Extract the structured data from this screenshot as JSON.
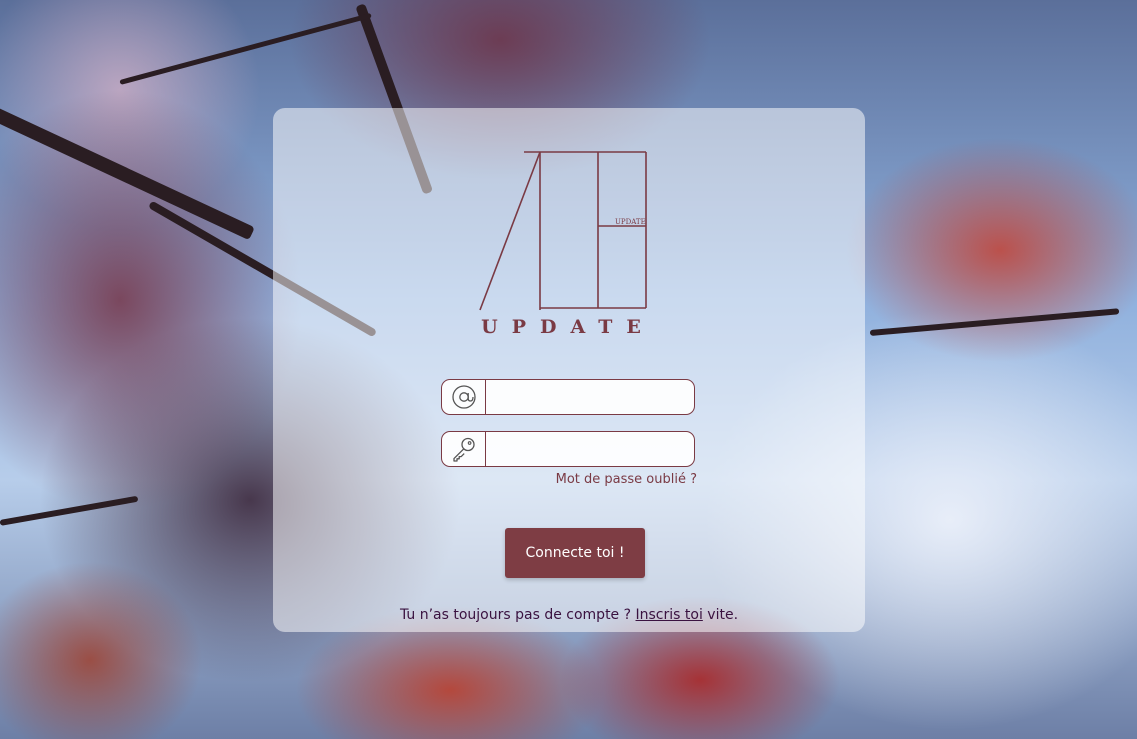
{
  "logo": {
    "name": "UPDATE",
    "small_text": "UPDATE",
    "color": "#7a3a44"
  },
  "email_field": {
    "icon": "at-sign-icon",
    "value": "",
    "placeholder": ""
  },
  "password_field": {
    "icon": "key-icon",
    "value": "",
    "placeholder": ""
  },
  "forgot_password": "Mot de passe oublié ?",
  "submit_label": "Connecte toi !",
  "signup": {
    "prefix": "Tu n’as toujours pas de compte ?",
    "link": "Inscris toi",
    "suffix": "vite."
  },
  "colors": {
    "accent": "#7e3d44",
    "text_dark": "#3a1240"
  }
}
